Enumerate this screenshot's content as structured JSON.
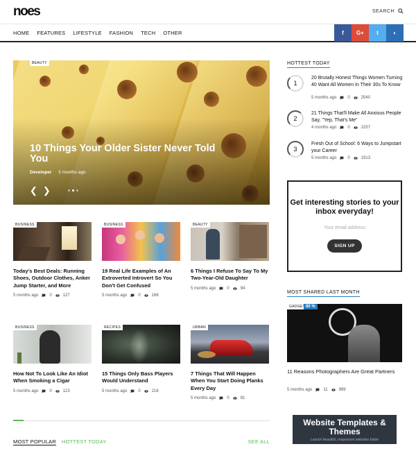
{
  "header": {
    "logo": "noes",
    "search_label": "SEARCH"
  },
  "nav": {
    "items": [
      "HOME",
      "FEATURES",
      "LIFESTYLE",
      "FASHION",
      "TECH",
      "OTHER"
    ]
  },
  "social": {
    "facebook": "f",
    "googleplus": "G+",
    "twitter": "t",
    "github": "◐",
    "colors": {
      "facebook": "#3b5998",
      "googleplus": "#dd4b39",
      "twitter": "#55acee",
      "github": "#2d6fb6"
    }
  },
  "hero": {
    "tag": "BEAUTY",
    "title": "10 Things Your Older Sister Never Told You",
    "author": "Developer",
    "time": "5 months ago",
    "prev": "❮",
    "next": "❯"
  },
  "cards": [
    {
      "tag": "BUSINESS",
      "title": "Today's Best Deals: Running Shoes, Outdoor Clothes, Anker Jump Starter, and More",
      "time": "5 months ago",
      "comments": "0",
      "views": "127",
      "image": "room-window"
    },
    {
      "tag": "BUSINESS",
      "title": "19 Real Life Examples of An Extroverted Introvert So You Don't Get Confused",
      "time": "5 months ago",
      "comments": "0",
      "views": "166",
      "image": "party"
    },
    {
      "tag": "BEAUTY",
      "title": "6 Things I Refuse To Say To My Two-Year-Old Daughter",
      "time": "5 months ago",
      "comments": "0",
      "views": "94",
      "image": "street-girl"
    },
    {
      "tag": "BUSINESS",
      "title": "How Not To Look Like An Idiot When Smoking a Cigar",
      "time": "5 months ago",
      "comments": "0",
      "views": "123",
      "image": "woman-eating"
    },
    {
      "tag": "RECIPES",
      "title": "15 Things Only Bass Players Would Understand",
      "time": "5 months ago",
      "comments": "0",
      "views": "216",
      "image": "smoke"
    },
    {
      "tag": "URBAN",
      "title": "7 Things That Will Happen When You Start Doing Planks Every Day",
      "time": "5 months ago",
      "comments": "0",
      "views": "81",
      "image": "red-car"
    }
  ],
  "tabs": {
    "most_popular": "MOST POPULAR",
    "hottest_today": "HOTTEST TODAY",
    "see_all": "SEE ALL"
  },
  "sidebar": {
    "hottest_heading": "HOTTEST TODAY",
    "ranked": [
      {
        "rank": "1",
        "title": "20 Brutally Honest Things Women Turning 40 Want All Women In Their 30s To Know",
        "time": "5 months ago",
        "comments": "0",
        "views": "2540"
      },
      {
        "rank": "2",
        "title": "21 Things That'll Make All Anxious People Say, \"Yep, That's Me\"",
        "time": "4 months ago",
        "comments": "0",
        "views": "2257"
      },
      {
        "rank": "3",
        "title": "Fresh Out of School: 6 Ways to Jumpstart your Career",
        "time": "5 months ago",
        "comments": "0",
        "views": "1913"
      }
    ],
    "newsletter": {
      "heading": "Get interesting stories to your inbox everyday!",
      "placeholder": "Your email address",
      "button": "SIGN UP"
    },
    "shared_heading": "MOST SHARED LAST MONTH",
    "shared": {
      "tag": "GADGET",
      "score": "80 %",
      "title": "11 Reasons Photographers Are Great Partners",
      "time": "5 months ago",
      "comments": "11",
      "views": "999"
    },
    "ad": {
      "title": "Website Templates & Themes",
      "subtitle": "Launch beautiful, responsive websites faster"
    }
  }
}
